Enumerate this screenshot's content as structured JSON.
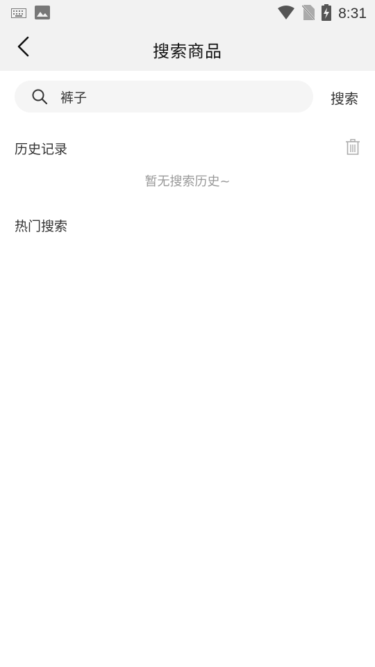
{
  "status_bar": {
    "time": "8:31",
    "icons": [
      "keyboard-icon",
      "image-icon",
      "wifi-icon",
      "no-sim-icon",
      "battery-charging-icon"
    ]
  },
  "header": {
    "title": "搜索商品",
    "back_icon": "chevron-left-icon"
  },
  "search": {
    "value": "裤子",
    "button_label": "搜索",
    "icon": "search-icon"
  },
  "history": {
    "title": "历史记录",
    "empty_text": "暂无搜索历史~",
    "delete_icon": "trash-icon"
  },
  "hot": {
    "title": "热门搜索"
  },
  "colors": {
    "header_bg": "#f2f2f2",
    "search_box_bg": "#f5f5f5",
    "hint_text": "#999999"
  }
}
